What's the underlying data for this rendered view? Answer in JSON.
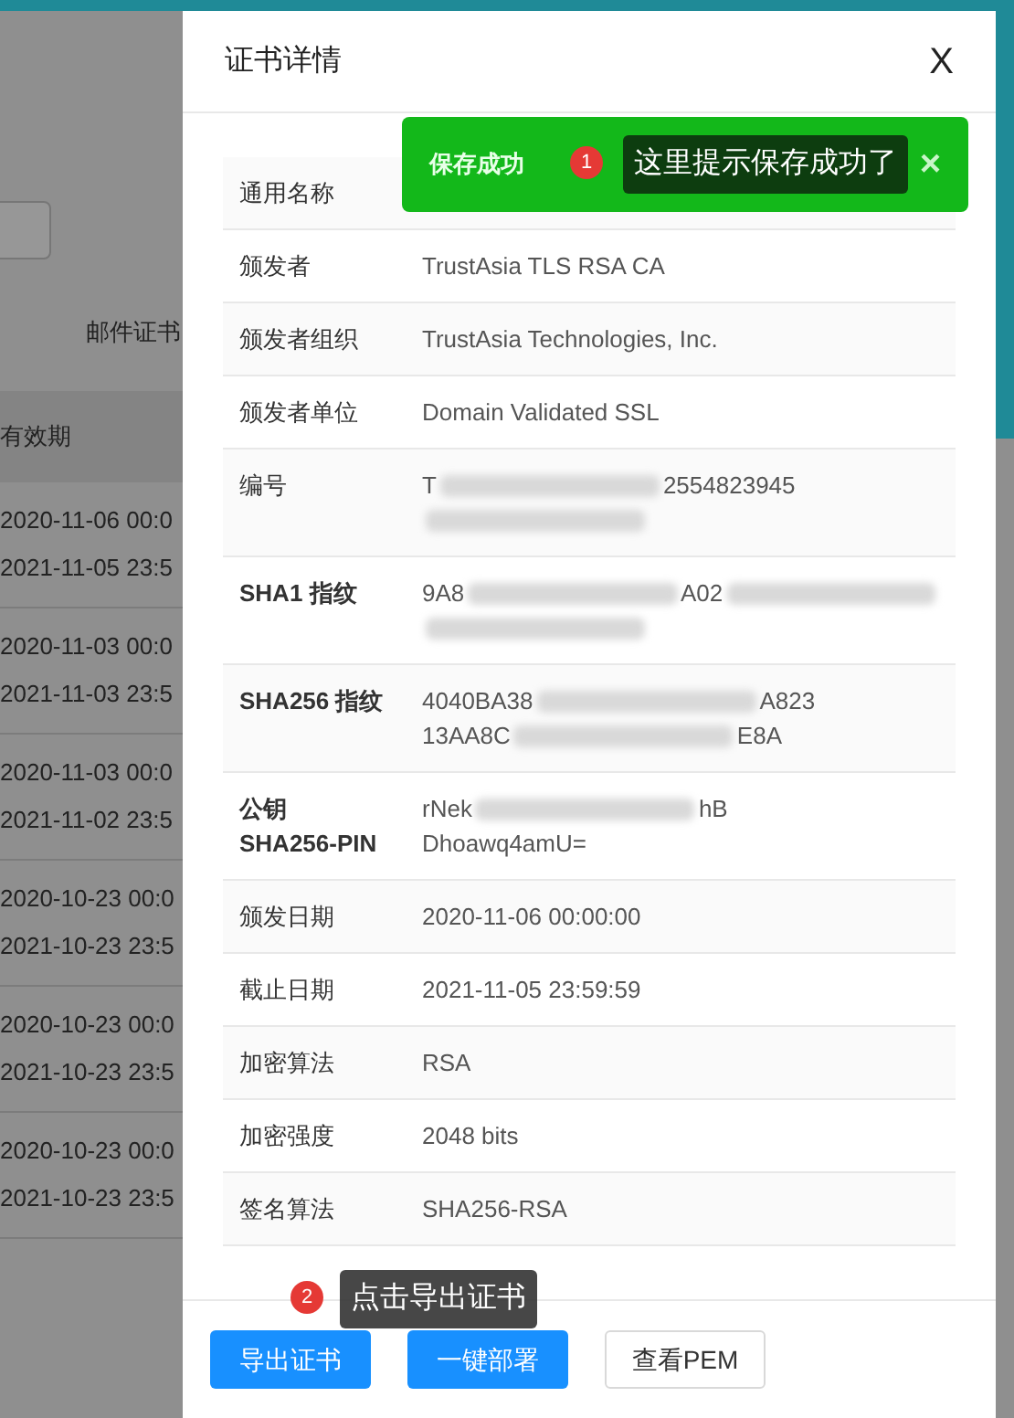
{
  "background_page": {
    "tab_label": "邮件证书",
    "table_header": "有效期",
    "rows": [
      {
        "start": "2020-11-06 00:0",
        "end": "2021-11-05 23:5"
      },
      {
        "start": "2020-11-03 00:0",
        "end": "2021-11-03 23:5"
      },
      {
        "start": "2020-11-03 00:0",
        "end": "2021-11-02 23:5"
      },
      {
        "start": "2020-10-23 00:0",
        "end": "2021-10-23 23:5"
      },
      {
        "start": "2020-10-23 00:0",
        "end": "2021-10-23 23:5"
      },
      {
        "start": "2020-10-23 00:0",
        "end": "2021-10-23 23:5"
      }
    ]
  },
  "dialog": {
    "title": "证书详情",
    "close": "X",
    "fields": [
      {
        "label": "通用名称"
      },
      {
        "label": "颁发者",
        "value": [
          {
            "kind": "text",
            "text": "TrustAsia TLS RSA CA"
          }
        ]
      },
      {
        "label": "颁发者组织",
        "value": [
          {
            "kind": "text",
            "text": "TrustAsia Technologies, Inc."
          }
        ]
      },
      {
        "label": "颁发者单位",
        "value": [
          {
            "kind": "text",
            "text": "Domain Validated SSL"
          }
        ]
      },
      {
        "label": "编号",
        "value": [
          {
            "kind": "text",
            "text": "T"
          },
          {
            "kind": "blur"
          },
          {
            "kind": "text",
            "text": "2554823945"
          },
          {
            "kind": "break"
          },
          {
            "kind": "blur"
          }
        ]
      },
      {
        "label": "SHA1 指纹",
        "bold": true,
        "value": [
          {
            "kind": "text",
            "text": "9A8"
          },
          {
            "kind": "blur"
          },
          {
            "kind": "text",
            "text": "A02"
          },
          {
            "kind": "blur"
          },
          {
            "kind": "break"
          },
          {
            "kind": "blur"
          }
        ]
      },
      {
        "label": "SHA256 指纹",
        "bold": true,
        "value": [
          {
            "kind": "text",
            "text": "4040BA38"
          },
          {
            "kind": "blur"
          },
          {
            "kind": "text",
            "text": "A823"
          },
          {
            "kind": "break"
          },
          {
            "kind": "text",
            "text": "13AA8C"
          },
          {
            "kind": "blur"
          },
          {
            "kind": "text",
            "text": "E8A"
          }
        ]
      },
      {
        "label": "公钥 SHA256-PIN",
        "bold": true,
        "value": [
          {
            "kind": "text",
            "text": "rNek"
          },
          {
            "kind": "blur"
          },
          {
            "kind": "text",
            "text": "hB"
          },
          {
            "kind": "break"
          },
          {
            "kind": "text",
            "text": "Dhoawq4amU="
          }
        ]
      },
      {
        "label": "颁发日期",
        "value": [
          {
            "kind": "text",
            "text": "2020-11-06 00:00:00"
          }
        ]
      },
      {
        "label": "截止日期",
        "value": [
          {
            "kind": "text",
            "text": "2021-11-05 23:59:59"
          }
        ]
      },
      {
        "label": "加密算法",
        "value": [
          {
            "kind": "text",
            "text": "RSA"
          }
        ]
      },
      {
        "label": "加密强度",
        "value": [
          {
            "kind": "text",
            "text": "2048 bits"
          }
        ]
      },
      {
        "label": "签名算法",
        "value": [
          {
            "kind": "text",
            "text": "SHA256-RSA"
          }
        ]
      }
    ],
    "buttons": [
      {
        "label": "导出证书",
        "kind": "primary"
      },
      {
        "label": "一键部署",
        "kind": "primary"
      },
      {
        "label": "查看PEM",
        "kind": "default"
      }
    ]
  },
  "toast": {
    "message": "保存成功",
    "close": "×"
  },
  "annotations": [
    {
      "number": "1",
      "text": "这里提示保存成功了"
    },
    {
      "number": "2",
      "text": "点击导出证书"
    }
  ]
}
